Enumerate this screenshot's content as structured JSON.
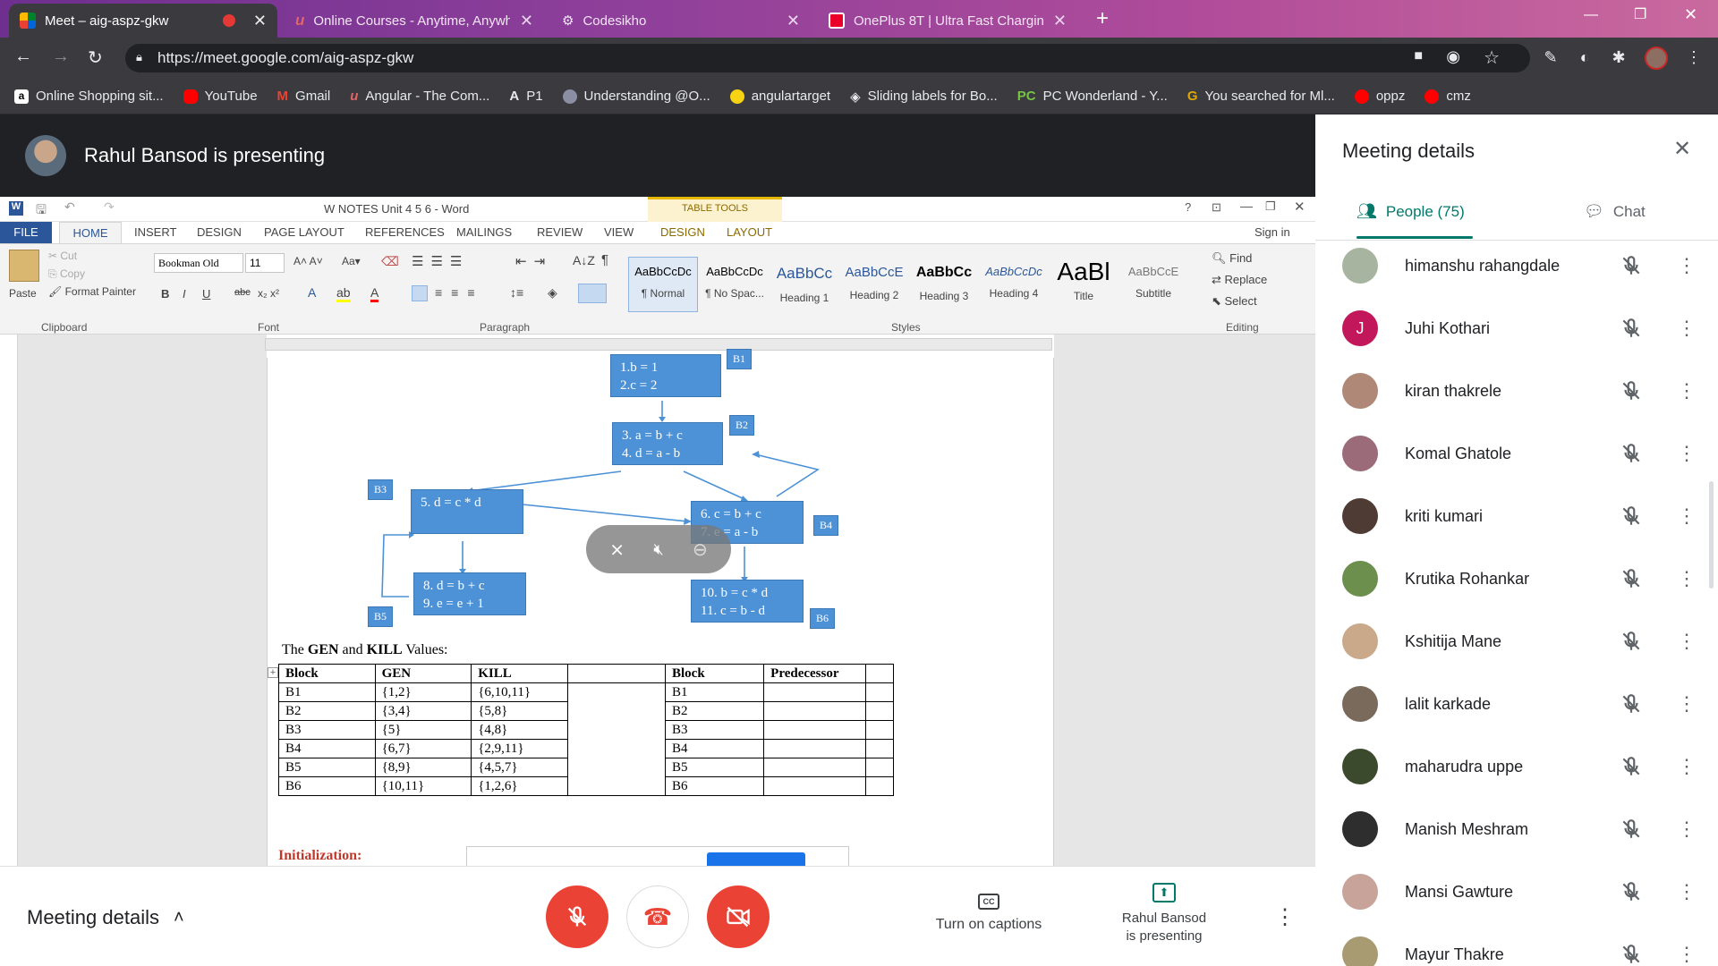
{
  "browser": {
    "tabs": [
      {
        "title": "Meet – aig-aspz-gkw",
        "active": true,
        "favicon_color": "#00832d"
      },
      {
        "title": "Online Courses - Anytime, Anywh",
        "active": false,
        "favicon_color": "#a435f0"
      },
      {
        "title": "Codesikho",
        "active": false,
        "favicon_color": "#ffffff"
      },
      {
        "title": "OnePlus 8T | Ultra Fast Charging",
        "active": false,
        "favicon_color": "#eb0029"
      }
    ],
    "url": "https://meet.google.com/aig-aspz-gkw",
    "bookmarks": [
      {
        "label": "Online Shopping sit...",
        "color": "#ffffff"
      },
      {
        "label": "YouTube",
        "color": "#ff0000"
      },
      {
        "label": "Gmail",
        "color": "#ea4335"
      },
      {
        "label": "Angular - The Com...",
        "color": "#dd0031"
      },
      {
        "label": "P1",
        "color": "#ffffff"
      },
      {
        "label": "Understanding @O...",
        "color": "#8a8fa3"
      },
      {
        "label": "angulartarget",
        "color": "#f7d313"
      },
      {
        "label": "Sliding labels for Bo...",
        "color": "#ffffff"
      },
      {
        "label": "PC Wonderland - Y...",
        "color": "#76c442"
      },
      {
        "label": "You searched for Ml...",
        "color": "#e0a800"
      },
      {
        "label": "oppz",
        "color": "#ff0000"
      },
      {
        "label": "cmz",
        "color": "#ff0000"
      }
    ]
  },
  "meet": {
    "presenter_text": "Rahul Bansod is presenting",
    "meeting_details_label": "Meeting details",
    "captions_label": "Turn on captions",
    "presenting_label_line1": "Rahul Bansod",
    "presenting_label_line2": "is presenting",
    "accent_red": "#ea4335",
    "accent_green": "#00796b"
  },
  "word": {
    "title": "W NOTES Unit 4 5 6 - Word",
    "table_tools": "TABLE TOOLS",
    "sign_in": "Sign in",
    "tabs": [
      "FILE",
      "HOME",
      "INSERT",
      "DESIGN",
      "PAGE LAYOUT",
      "REFERENCES",
      "MAILINGS",
      "REVIEW",
      "VIEW",
      "DESIGN",
      "LAYOUT"
    ],
    "clipboard": {
      "paste": "Paste",
      "cut": "Cut",
      "copy": "Copy",
      "format_painter": "Format Painter",
      "label": "Clipboard"
    },
    "font": {
      "name": "Bookman Old",
      "size": "11",
      "label": "Font"
    },
    "paragraph_label": "Paragraph",
    "styles": [
      {
        "preview": "AaBbCcDc",
        "label": "¶ Normal"
      },
      {
        "preview": "AaBbCcDc",
        "label": "¶ No Spac..."
      },
      {
        "preview": "AaBbCc",
        "label": "Heading 1"
      },
      {
        "preview": "AaBbCcE",
        "label": "Heading 2"
      },
      {
        "preview": "AaBbCc",
        "label": "Heading 3"
      },
      {
        "preview": "AaBbCcDc",
        "label": "Heading 4"
      },
      {
        "preview": "AaBl",
        "label": "Title"
      },
      {
        "preview": "AaBbCcE",
        "label": "Subtitle"
      }
    ],
    "styles_label": "Styles",
    "editing": {
      "find": "Find",
      "replace": "Replace",
      "select": "Select",
      "label": "Editing"
    }
  },
  "document": {
    "nodes": {
      "b1": [
        "1.b = 1",
        "2.c = 2"
      ],
      "b2": [
        "3. a = b + c",
        "4. d = a - b"
      ],
      "b3": [
        "5. d = c * d"
      ],
      "b4": [
        "6. c = b + c",
        "7. e = a - b"
      ],
      "b5": [
        "8. d = b + c",
        "9. e = e + 1"
      ],
      "b6": [
        "10. b = c * d",
        "11. c = b - d"
      ]
    },
    "block_labels": [
      "B1",
      "B2",
      "B3",
      "B4",
      "B5",
      "B6"
    ],
    "gen_kill_heading_pre": "The ",
    "gen_word": "GEN",
    "and_word": " and ",
    "kill_word": "KILL",
    "gen_kill_heading_post": " Values:",
    "gen_kill_table": {
      "headers": [
        "Block",
        "GEN",
        "KILL"
      ],
      "rows": [
        [
          "B1",
          "{1,2}",
          "{6,10,11}"
        ],
        [
          "B2",
          "{3,4}",
          "{5,8}"
        ],
        [
          "B3",
          "{5}",
          "{4,8}"
        ],
        [
          "B4",
          "{6,7}",
          "{2,9,11}"
        ],
        [
          "B5",
          "{8,9}",
          "{4,5,7}"
        ],
        [
          "B6",
          "{10,11}",
          "{1,2,6}"
        ]
      ]
    },
    "pred_table": {
      "headers": [
        "Block",
        "Predecessor"
      ],
      "rows": [
        "B1",
        "B2",
        "B3",
        "B4",
        "B5",
        "B6"
      ]
    },
    "initialization": "Initialization:"
  },
  "panel": {
    "title": "Meeting details",
    "people_tab": "People (75)",
    "chat_tab": "Chat",
    "people": [
      {
        "name": "himanshu rahangdale",
        "color": "#a7b5a0"
      },
      {
        "name": "Juhi Kothari",
        "color": "#c2185b",
        "initial": "J"
      },
      {
        "name": "kiran thakrele",
        "color": "#b08878"
      },
      {
        "name": "Komal Ghatole",
        "color": "#9c6b7a"
      },
      {
        "name": "kriti kumari",
        "color": "#4e3b34"
      },
      {
        "name": "Krutika Rohankar",
        "color": "#6d8f4e"
      },
      {
        "name": "Kshitija Mane",
        "color": "#c9a989"
      },
      {
        "name": "lalit karkade",
        "color": "#7a6a5b"
      },
      {
        "name": "maharudra uppe",
        "color": "#3b4a2c"
      },
      {
        "name": "Manish Meshram",
        "color": "#2e2e2e"
      },
      {
        "name": "Mansi Gawture",
        "color": "#c7a39a"
      },
      {
        "name": "Mayur Thakre",
        "color": "#a89b72"
      }
    ]
  }
}
